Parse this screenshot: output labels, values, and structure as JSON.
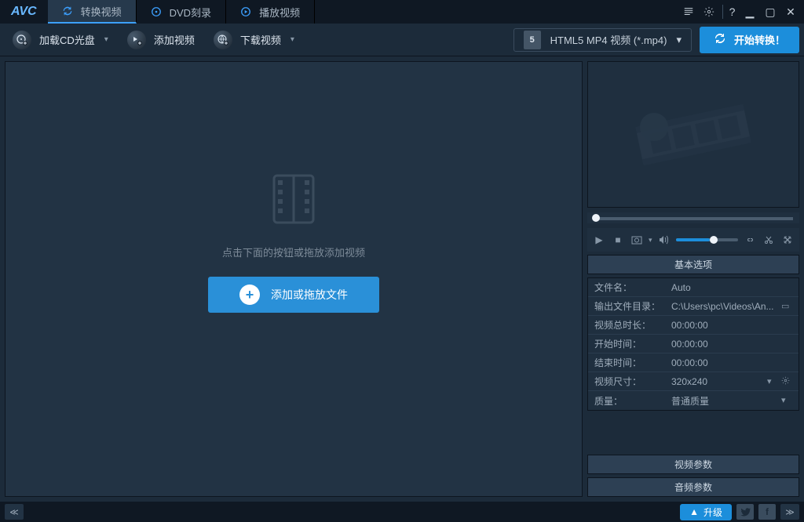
{
  "app": {
    "logo": "AVC"
  },
  "tabs": [
    {
      "label": "转换视频",
      "active": true
    },
    {
      "label": "DVD刻录",
      "active": false
    },
    {
      "label": "播放视频",
      "active": false
    }
  ],
  "toolbar": {
    "load_cd": "加载CD光盘",
    "add_video": "添加视频",
    "download_video": "下载视频",
    "format_selected": "HTML5 MP4 视频 (*.mp4)",
    "start_convert": "开始转换！"
  },
  "dropzone": {
    "hint": "点击下面的按钮或拖放添加视频",
    "add_button": "添加或拖放文件"
  },
  "panel": {
    "basic_header": "基本选项",
    "rows": {
      "filename_label": "文件名：",
      "filename_value": "Auto",
      "outdir_label": "输出文件目录：",
      "outdir_value": "C:\\Users\\pc\\Videos\\An...",
      "duration_label": "视频总时长：",
      "duration_value": "00:00:00",
      "start_label": "开始时间：",
      "start_value": "00:00:00",
      "end_label": "结束时间：",
      "end_value": "00:00:00",
      "size_label": "视频尺寸：",
      "size_value": "320x240",
      "quality_label": "质量：",
      "quality_value": "普通质量"
    },
    "video_params_header": "视频参数",
    "audio_params_header": "音频参数"
  },
  "statusbar": {
    "upgrade": "升级"
  }
}
